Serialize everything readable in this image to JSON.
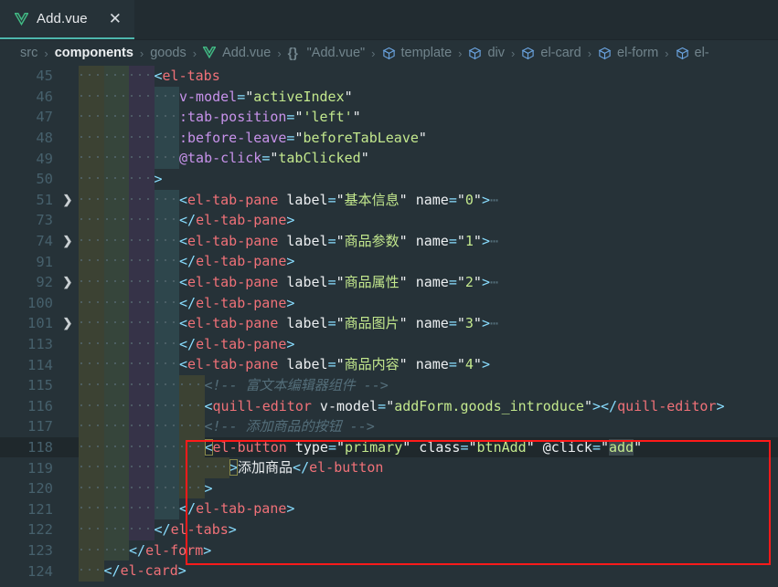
{
  "window": {
    "tab": {
      "title": "Add.vue",
      "icon": "vue-logo-icon",
      "close": "✕"
    }
  },
  "breadcrumb": {
    "separator": "›",
    "items": [
      {
        "label": "src",
        "icon": "",
        "active": false
      },
      {
        "label": "components",
        "icon": "",
        "active": true
      },
      {
        "label": "goods",
        "icon": "",
        "active": false
      },
      {
        "label": "Add.vue",
        "icon": "vue-logo-icon",
        "active": false
      },
      {
        "label": "\"Add.vue\"",
        "icon": "braces-icon",
        "active": false
      },
      {
        "label": "template",
        "icon": "cube-icon",
        "active": false
      },
      {
        "label": "div",
        "icon": "cube-icon",
        "active": false
      },
      {
        "label": "el-card",
        "icon": "cube-icon",
        "active": false
      },
      {
        "label": "el-form",
        "icon": "cube-icon",
        "active": false
      },
      {
        "label": "el-",
        "icon": "cube-icon",
        "active": false
      }
    ]
  },
  "editor": {
    "language": "vue",
    "current_line": 118,
    "selected_word": "add",
    "colors": {
      "background": "#263238",
      "tag": "#f07178",
      "attribute": "#c792ea",
      "string": "#c3e88d",
      "punctuation": "#89ddff",
      "comment": "#546e7a",
      "annotation_box": "#ff1a1a",
      "tab_underline": "#4db6ac"
    },
    "lines": [
      {
        "num": "45",
        "fold": "",
        "indent": 4,
        "text": "<el-tabs"
      },
      {
        "num": "46",
        "fold": "",
        "indent": 5,
        "text": "v-model=\"activeIndex\""
      },
      {
        "num": "47",
        "fold": "",
        "indent": 5,
        "text": ":tab-position=\"'left'\""
      },
      {
        "num": "48",
        "fold": "",
        "indent": 5,
        "text": ":before-leave=\"beforeTabLeave\""
      },
      {
        "num": "49",
        "fold": "",
        "indent": 5,
        "text": "@tab-click=\"tabClicked\""
      },
      {
        "num": "50",
        "fold": "",
        "indent": 4,
        "text": ">"
      },
      {
        "num": "51",
        "fold": "❯",
        "indent": 5,
        "text": "<el-tab-pane label=\"基本信息\" name=\"0\">⋯"
      },
      {
        "num": "73",
        "fold": "",
        "indent": 5,
        "text": "</el-tab-pane>"
      },
      {
        "num": "74",
        "fold": "❯",
        "indent": 5,
        "text": "<el-tab-pane label=\"商品参数\" name=\"1\">⋯"
      },
      {
        "num": "91",
        "fold": "",
        "indent": 5,
        "text": "</el-tab-pane>"
      },
      {
        "num": "92",
        "fold": "❯",
        "indent": 5,
        "text": "<el-tab-pane label=\"商品属性\" name=\"2\">⋯"
      },
      {
        "num": "100",
        "fold": "",
        "indent": 5,
        "text": "</el-tab-pane>"
      },
      {
        "num": "101",
        "fold": "❯",
        "indent": 5,
        "text": "<el-tab-pane label=\"商品图片\" name=\"3\">⋯"
      },
      {
        "num": "113",
        "fold": "",
        "indent": 5,
        "text": "</el-tab-pane>"
      },
      {
        "num": "114",
        "fold": "",
        "indent": 5,
        "text": "<el-tab-pane label=\"商品内容\" name=\"4\">"
      },
      {
        "num": "115",
        "fold": "",
        "indent": 6,
        "text": "<!-- 富文本编辑器组件 -->"
      },
      {
        "num": "116",
        "fold": "",
        "indent": 6,
        "text": "<quill-editor v-model=\"addForm.goods_introduce\"></quill-editor>"
      },
      {
        "num": "117",
        "fold": "",
        "indent": 6,
        "text": "<!-- 添加商品的按钮 -->"
      },
      {
        "num": "118",
        "fold": "",
        "indent": 6,
        "text": "<el-button type=\"primary\" class=\"btnAdd\" @click=\"add\""
      },
      {
        "num": "119",
        "fold": "",
        "indent": 7,
        "text": ">添加商品</el-button"
      },
      {
        "num": "120",
        "fold": "",
        "indent": 6,
        "text": ">"
      },
      {
        "num": "121",
        "fold": "",
        "indent": 5,
        "text": "</el-tab-pane>"
      },
      {
        "num": "122",
        "fold": "",
        "indent": 4,
        "text": "</el-tabs>"
      },
      {
        "num": "123",
        "fold": "",
        "indent": 3,
        "text": "</el-form>"
      },
      {
        "num": "124",
        "fold": "",
        "indent": 2,
        "text": "</el-card>"
      }
    ]
  },
  "annotation": {
    "name": "red-highlight-box",
    "covers_lines": "115-120",
    "color": "#ff1a1a"
  }
}
